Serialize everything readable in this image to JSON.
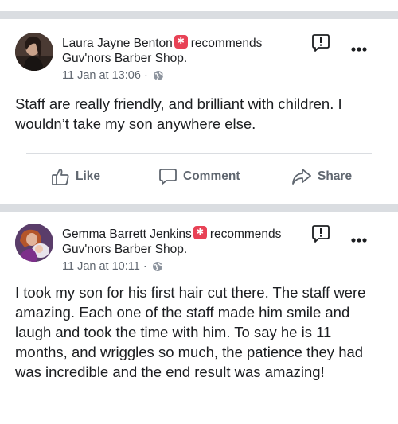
{
  "posts": [
    {
      "author": "Laura Jayne Benton",
      "action_word": "recommends",
      "business": "Guv'nors Barber Shop.",
      "timestamp": "11 Jan at 13:06",
      "separator": "·",
      "privacy_icon": "globe-icon",
      "text": "Staff are really friendly, and brilliant with children. I wouldn’t take my son anywhere else.",
      "actions": {
        "like": "Like",
        "comment": "Comment",
        "share": "Share"
      }
    },
    {
      "author": "Gemma Barrett Jenkins",
      "action_word": "recommends",
      "business": "Guv'nors Barber Shop.",
      "timestamp": "11 Jan at 10:11",
      "separator": "·",
      "privacy_icon": "globe-icon",
      "text": "I took my son for his first hair cut there. The staff were amazing. Each one of the staff made him smile and laugh and took the time with him. To say he is 11 months, and wriggles so much, the patience they had was incredible and the end result was amazing!"
    }
  ],
  "colors": {
    "recommend_badge": "#e84256",
    "secondary_text": "#606770",
    "separator": "#dadde1"
  }
}
